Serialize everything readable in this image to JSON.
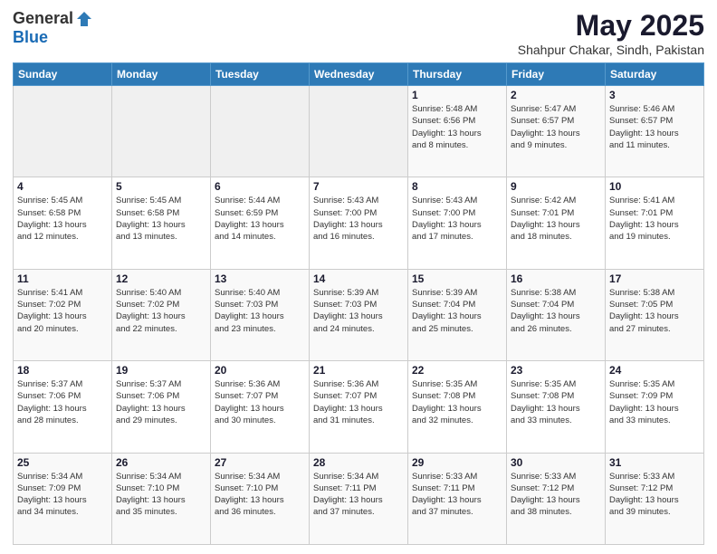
{
  "logo": {
    "general": "General",
    "blue": "Blue"
  },
  "title": "May 2025",
  "subtitle": "Shahpur Chakar, Sindh, Pakistan",
  "days_header": [
    "Sunday",
    "Monday",
    "Tuesday",
    "Wednesday",
    "Thursday",
    "Friday",
    "Saturday"
  ],
  "weeks": [
    [
      {
        "day": "",
        "info": ""
      },
      {
        "day": "",
        "info": ""
      },
      {
        "day": "",
        "info": ""
      },
      {
        "day": "",
        "info": ""
      },
      {
        "day": "1",
        "info": "Sunrise: 5:48 AM\nSunset: 6:56 PM\nDaylight: 13 hours\nand 8 minutes."
      },
      {
        "day": "2",
        "info": "Sunrise: 5:47 AM\nSunset: 6:57 PM\nDaylight: 13 hours\nand 9 minutes."
      },
      {
        "day": "3",
        "info": "Sunrise: 5:46 AM\nSunset: 6:57 PM\nDaylight: 13 hours\nand 11 minutes."
      }
    ],
    [
      {
        "day": "4",
        "info": "Sunrise: 5:45 AM\nSunset: 6:58 PM\nDaylight: 13 hours\nand 12 minutes."
      },
      {
        "day": "5",
        "info": "Sunrise: 5:45 AM\nSunset: 6:58 PM\nDaylight: 13 hours\nand 13 minutes."
      },
      {
        "day": "6",
        "info": "Sunrise: 5:44 AM\nSunset: 6:59 PM\nDaylight: 13 hours\nand 14 minutes."
      },
      {
        "day": "7",
        "info": "Sunrise: 5:43 AM\nSunset: 7:00 PM\nDaylight: 13 hours\nand 16 minutes."
      },
      {
        "day": "8",
        "info": "Sunrise: 5:43 AM\nSunset: 7:00 PM\nDaylight: 13 hours\nand 17 minutes."
      },
      {
        "day": "9",
        "info": "Sunrise: 5:42 AM\nSunset: 7:01 PM\nDaylight: 13 hours\nand 18 minutes."
      },
      {
        "day": "10",
        "info": "Sunrise: 5:41 AM\nSunset: 7:01 PM\nDaylight: 13 hours\nand 19 minutes."
      }
    ],
    [
      {
        "day": "11",
        "info": "Sunrise: 5:41 AM\nSunset: 7:02 PM\nDaylight: 13 hours\nand 20 minutes."
      },
      {
        "day": "12",
        "info": "Sunrise: 5:40 AM\nSunset: 7:02 PM\nDaylight: 13 hours\nand 22 minutes."
      },
      {
        "day": "13",
        "info": "Sunrise: 5:40 AM\nSunset: 7:03 PM\nDaylight: 13 hours\nand 23 minutes."
      },
      {
        "day": "14",
        "info": "Sunrise: 5:39 AM\nSunset: 7:03 PM\nDaylight: 13 hours\nand 24 minutes."
      },
      {
        "day": "15",
        "info": "Sunrise: 5:39 AM\nSunset: 7:04 PM\nDaylight: 13 hours\nand 25 minutes."
      },
      {
        "day": "16",
        "info": "Sunrise: 5:38 AM\nSunset: 7:04 PM\nDaylight: 13 hours\nand 26 minutes."
      },
      {
        "day": "17",
        "info": "Sunrise: 5:38 AM\nSunset: 7:05 PM\nDaylight: 13 hours\nand 27 minutes."
      }
    ],
    [
      {
        "day": "18",
        "info": "Sunrise: 5:37 AM\nSunset: 7:06 PM\nDaylight: 13 hours\nand 28 minutes."
      },
      {
        "day": "19",
        "info": "Sunrise: 5:37 AM\nSunset: 7:06 PM\nDaylight: 13 hours\nand 29 minutes."
      },
      {
        "day": "20",
        "info": "Sunrise: 5:36 AM\nSunset: 7:07 PM\nDaylight: 13 hours\nand 30 minutes."
      },
      {
        "day": "21",
        "info": "Sunrise: 5:36 AM\nSunset: 7:07 PM\nDaylight: 13 hours\nand 31 minutes."
      },
      {
        "day": "22",
        "info": "Sunrise: 5:35 AM\nSunset: 7:08 PM\nDaylight: 13 hours\nand 32 minutes."
      },
      {
        "day": "23",
        "info": "Sunrise: 5:35 AM\nSunset: 7:08 PM\nDaylight: 13 hours\nand 33 minutes."
      },
      {
        "day": "24",
        "info": "Sunrise: 5:35 AM\nSunset: 7:09 PM\nDaylight: 13 hours\nand 33 minutes."
      }
    ],
    [
      {
        "day": "25",
        "info": "Sunrise: 5:34 AM\nSunset: 7:09 PM\nDaylight: 13 hours\nand 34 minutes."
      },
      {
        "day": "26",
        "info": "Sunrise: 5:34 AM\nSunset: 7:10 PM\nDaylight: 13 hours\nand 35 minutes."
      },
      {
        "day": "27",
        "info": "Sunrise: 5:34 AM\nSunset: 7:10 PM\nDaylight: 13 hours\nand 36 minutes."
      },
      {
        "day": "28",
        "info": "Sunrise: 5:34 AM\nSunset: 7:11 PM\nDaylight: 13 hours\nand 37 minutes."
      },
      {
        "day": "29",
        "info": "Sunrise: 5:33 AM\nSunset: 7:11 PM\nDaylight: 13 hours\nand 37 minutes."
      },
      {
        "day": "30",
        "info": "Sunrise: 5:33 AM\nSunset: 7:12 PM\nDaylight: 13 hours\nand 38 minutes."
      },
      {
        "day": "31",
        "info": "Sunrise: 5:33 AM\nSunset: 7:12 PM\nDaylight: 13 hours\nand 39 minutes."
      }
    ]
  ]
}
